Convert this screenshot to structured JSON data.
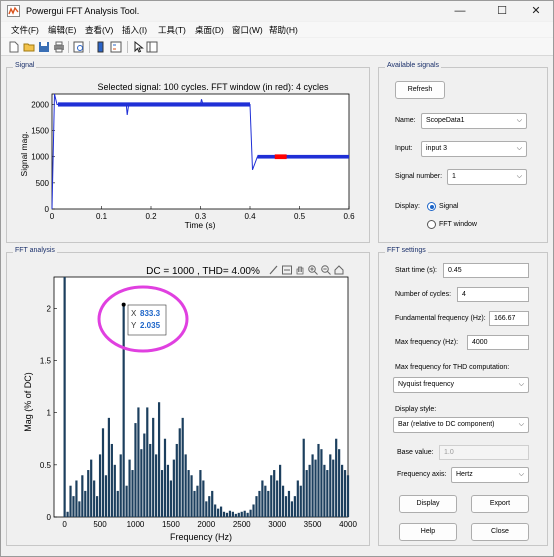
{
  "window": {
    "title": "Powergui FFT Analysis Tool."
  },
  "window_controls": {
    "minimize": "—",
    "maximize": "☐",
    "close": "✕"
  },
  "menu": [
    "文件(F)",
    "编辑(E)",
    "查看(V)",
    "插入(I)",
    "工具(T)",
    "桌面(D)",
    "窗口(W)",
    "帮助(H)"
  ],
  "panels": {
    "signal": "Signal",
    "available": "Available signals",
    "fft": "FFT analysis",
    "settings": "FFT settings"
  },
  "signal_plot": {
    "title": "Selected signal: 100 cycles. FFT window (in red): 4 cycles",
    "xlabel": "Time (s)",
    "ylabel": "Signal mag.",
    "xticks": [
      "0",
      "0.1",
      "0.2",
      "0.3",
      "0.4",
      "0.5",
      "0.6"
    ],
    "yticks": [
      "0",
      "500",
      "1000",
      "1500",
      "2000"
    ]
  },
  "fft_plot": {
    "title": "DC = 1000 , THD= 4.00%",
    "xlabel": "Frequency (Hz)",
    "ylabel": "Mag (% of DC)",
    "xticks": [
      "0",
      "500",
      "1000",
      "1500",
      "2000",
      "2500",
      "3000",
      "3500",
      "4000"
    ],
    "yticks": [
      "0",
      "0.5",
      "1",
      "1.5",
      "2"
    ],
    "datatip": {
      "x_label": "X",
      "x_value": "833.3",
      "y_label": "Y",
      "y_value": "2.035"
    },
    "highlight_color": "#e040e0"
  },
  "available": {
    "refresh_label": "Refresh",
    "name_label": "Name:",
    "name_value": "ScopeData1",
    "input_label": "Input:",
    "input_value": "input 3",
    "signal_number_label": "Signal number:",
    "signal_number_value": "1",
    "display_label": "Display:",
    "display_signal": "Signal",
    "display_fft": "FFT window"
  },
  "settings": {
    "start_time_label": "Start time (s):",
    "start_time_value": "0.45",
    "cycles_label": "Number of cycles:",
    "cycles_value": "4",
    "fund_label": "Fundamental frequency (Hz):",
    "fund_value": "166.67",
    "maxfreq_label": "Max frequency (Hz):",
    "maxfreq_value": "4000",
    "thd_label": "Max frequency for THD computation:",
    "thd_value": "Nyquist frequency",
    "style_label": "Display style:",
    "style_value": "Bar (relative to DC component)",
    "base_label": "Base value:",
    "base_value": "1.0",
    "axis_label": "Frequency axis:",
    "axis_value": "Hertz"
  },
  "buttons": {
    "display": "Display",
    "export": "Export",
    "help": "Help",
    "close": "Close"
  },
  "chart_data": [
    {
      "type": "line",
      "title": "Selected signal: 100 cycles. FFT window (in red): 4 cycles",
      "xlabel": "Time (s)",
      "ylabel": "Signal mag.",
      "xlim": [
        0,
        0.6
      ],
      "ylim": [
        0,
        2200
      ],
      "series": [
        {
          "values_xy": [
            [
              0,
              0
            ],
            [
              0.005,
              2200
            ],
            [
              0.01,
              2000
            ],
            [
              0.15,
              2000
            ],
            [
              0.152,
              1800
            ],
            [
              0.155,
              2000
            ],
            [
              0.3,
              2000
            ],
            [
              0.302,
              2100
            ],
            [
              0.305,
              2000
            ],
            [
              0.4,
              2000
            ],
            [
              0.405,
              750
            ],
            [
              0.415,
              1000
            ],
            [
              0.6,
              1000
            ]
          ]
        }
      ],
      "highlight_x_range": [
        0.45,
        0.474
      ],
      "colors": {
        "signal": "#1f2fd6",
        "fft_window": "#ff0000"
      }
    },
    {
      "type": "bar",
      "title": "DC = 1000 , THD= 4.00%",
      "xlabel": "Frequency (Hz)",
      "ylabel": "Mag (% of DC)",
      "xlim": [
        -150,
        4000
      ],
      "ylim": [
        0,
        2.3
      ],
      "x": [
        0,
        41.7,
        83.3,
        125,
        166.7,
        208.3,
        250,
        291.7,
        333.3,
        375,
        416.7,
        458.3,
        500,
        541.7,
        583.3,
        625,
        666.7,
        708.3,
        750,
        791.7,
        833.3,
        875,
        916.7,
        958.3,
        1000,
        1041.7,
        1083.3,
        1125,
        1166.7,
        1208.3,
        1250,
        1291.7,
        1333.3,
        1375,
        1416.7,
        1458.3,
        1500,
        1541.7,
        1583.3,
        1625,
        1666.7,
        1708.3,
        1750,
        1791.7,
        1833.3,
        1875,
        1916.7,
        1958.3,
        2000,
        2041.7,
        2083.3,
        2125,
        2166.7,
        2208.3,
        2250,
        2291.7,
        2333.3,
        2375,
        2416.7,
        2458.3,
        2500,
        2541.7,
        2583.3,
        2625,
        2666.7,
        2708.3,
        2750,
        2791.7,
        2833.3,
        2875,
        2916.7,
        2958.3,
        3000,
        3041.7,
        3083.3,
        3125,
        3166.7,
        3208.3,
        3250,
        3291.7,
        3333.3,
        3375,
        3416.7,
        3458.3,
        3500,
        3541.7,
        3583.3,
        3625,
        3666.7,
        3708.3,
        3750,
        3791.7,
        3833.3,
        3875,
        3916.7,
        3958.3,
        4000
      ],
      "values": [
        2.3,
        0.05,
        0.3,
        0.2,
        0.35,
        0.15,
        0.4,
        0.25,
        0.45,
        0.55,
        0.35,
        0.2,
        0.6,
        0.85,
        0.4,
        0.95,
        0.7,
        0.5,
        0.25,
        0.6,
        2.035,
        0.3,
        0.55,
        0.45,
        0.9,
        1.05,
        0.65,
        0.8,
        1.05,
        0.7,
        0.95,
        0.6,
        1.1,
        0.45,
        0.75,
        0.5,
        0.35,
        0.55,
        0.7,
        0.85,
        0.95,
        0.6,
        0.45,
        0.4,
        0.25,
        0.3,
        0.45,
        0.35,
        0.15,
        0.2,
        0.25,
        0.12,
        0.08,
        0.1,
        0.05,
        0.04,
        0.06,
        0.05,
        0.03,
        0.04,
        0.05,
        0.06,
        0.04,
        0.07,
        0.12,
        0.2,
        0.25,
        0.35,
        0.3,
        0.25,
        0.4,
        0.45,
        0.35,
        0.5,
        0.3,
        0.2,
        0.25,
        0.15,
        0.2,
        0.35,
        0.3,
        0.75,
        0.45,
        0.5,
        0.6,
        0.55,
        0.7,
        0.65,
        0.5,
        0.45,
        0.6,
        0.55,
        0.75,
        0.65,
        0.5,
        0.45,
        0.4,
        0.3
      ],
      "colors": {
        "bar": "#1c3f5e"
      }
    }
  ]
}
